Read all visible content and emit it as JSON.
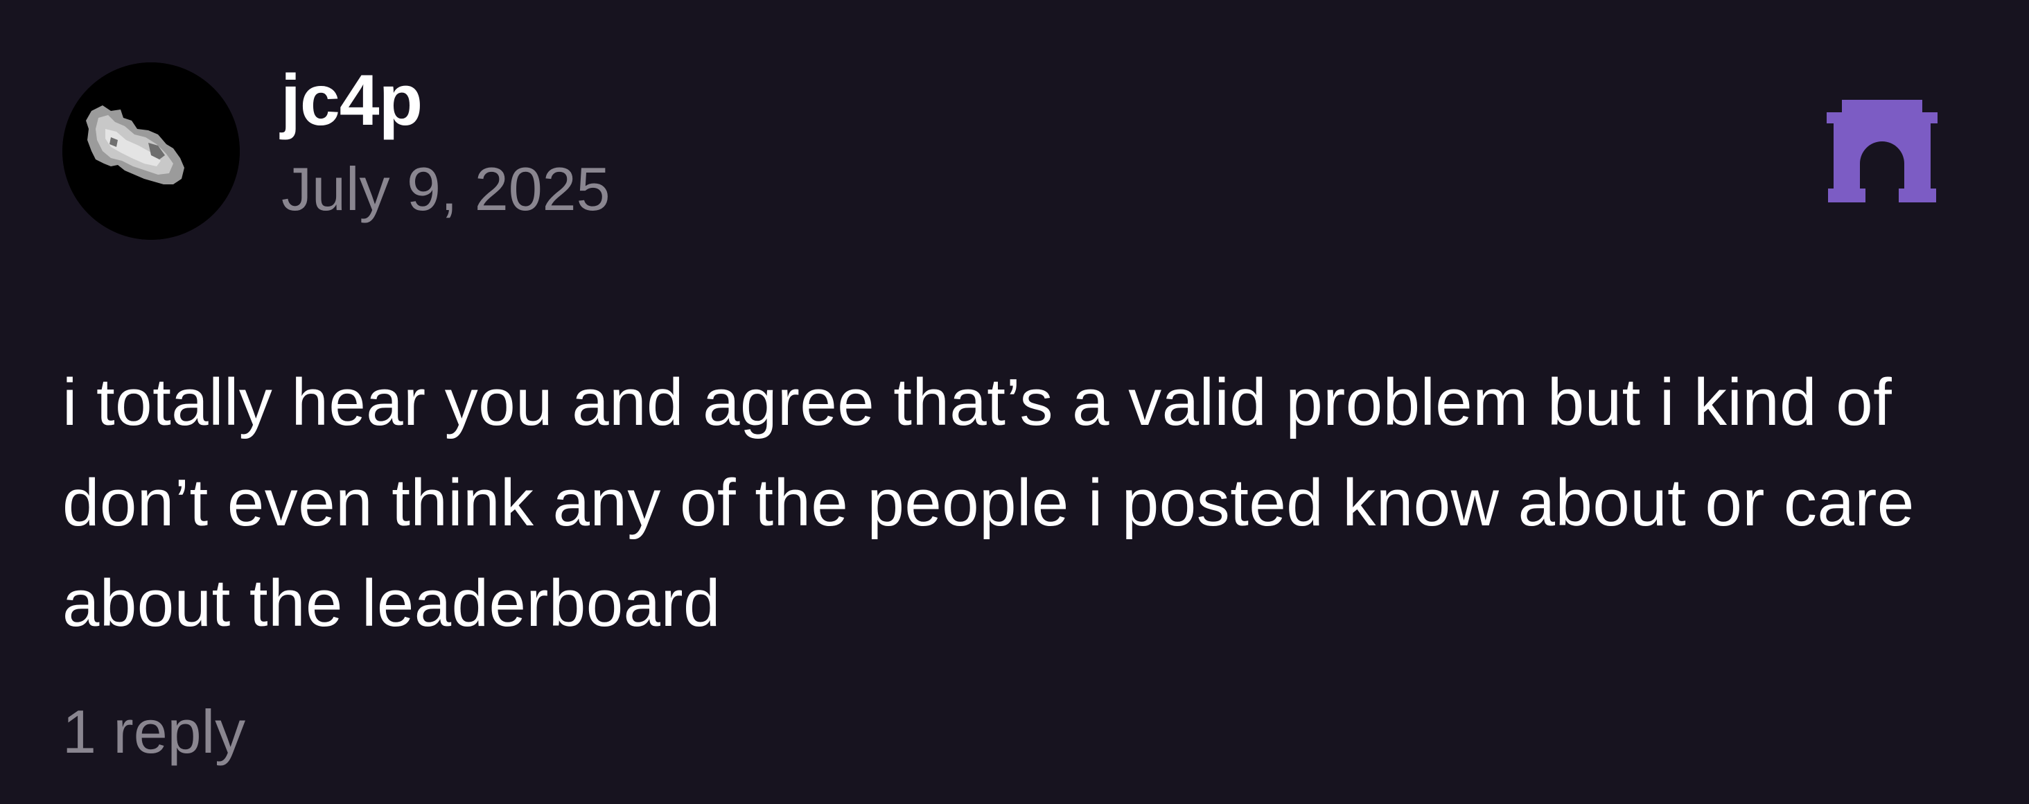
{
  "post": {
    "author": "jc4p",
    "date": "July 9, 2025",
    "avatar_icon": "avatar-image",
    "brand_icon": "arch-icon",
    "brand_color": "#7c5cc4",
    "text": "i totally hear you and agree that’s a valid problem but i kind of don’t even think any of the people i posted know about or care about the leaderboard",
    "replies": "1 reply"
  },
  "colors": {
    "background": "#17131f",
    "primary_text": "#ffffff",
    "secondary_text": "#8a8690"
  }
}
